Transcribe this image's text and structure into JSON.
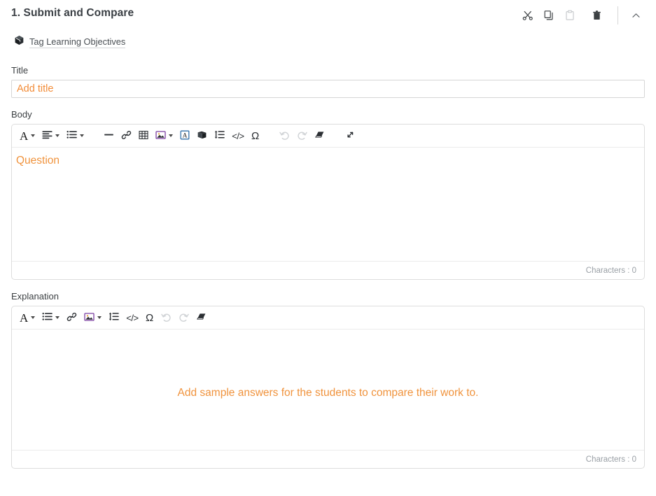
{
  "header": {
    "title": "1. Submit and Compare",
    "actions": [
      {
        "name": "cut-button",
        "icon": "scissors-icon",
        "label": "Cut",
        "disabled": false
      },
      {
        "name": "copy-button",
        "icon": "copy-icon",
        "label": "Copy",
        "disabled": false
      },
      {
        "name": "paste-button",
        "icon": "paste-icon",
        "label": "Paste",
        "disabled": true
      },
      {
        "name": "delete-button",
        "icon": "trash-icon",
        "label": "Delete",
        "disabled": false
      },
      {
        "name": "collapse-button",
        "icon": "chevron-up-icon",
        "label": "Collapse",
        "disabled": false
      }
    ]
  },
  "tag": {
    "icon": "cube-icon",
    "label": "Tag Learning Objectives"
  },
  "title_field": {
    "label": "Title",
    "value": "",
    "placeholder": "Add title"
  },
  "body_field": {
    "label": "Body",
    "placeholder": "Question",
    "character_count": "Characters : 0",
    "toolbar": [
      {
        "name": "font-button",
        "icon": "font-A-icon",
        "glyph": "A",
        "caret": true,
        "disabled": false
      },
      {
        "name": "align-button",
        "icon": "align-left-icon",
        "caret": true,
        "disabled": false
      },
      {
        "name": "list-button",
        "icon": "bullet-list-icon",
        "caret": true,
        "disabled": false
      },
      {
        "name": "horizontal-rule-button",
        "icon": "horizontal-rule-icon",
        "caret": false,
        "disabled": false
      },
      {
        "name": "link-button",
        "icon": "link-icon",
        "caret": false,
        "disabled": false
      },
      {
        "name": "table-button",
        "icon": "table-icon",
        "caret": false,
        "disabled": false
      },
      {
        "name": "image-button",
        "icon": "image-icon",
        "caret": true,
        "disabled": false
      },
      {
        "name": "text-box-button",
        "icon": "text-box-icon",
        "caret": false,
        "disabled": false
      },
      {
        "name": "flashcard-button",
        "icon": "book-icon",
        "caret": false,
        "disabled": false
      },
      {
        "name": "line-height-button",
        "icon": "line-height-icon",
        "caret": false,
        "disabled": false
      },
      {
        "name": "code-button",
        "icon": "code-icon",
        "glyph": "</>",
        "caret": false,
        "disabled": false
      },
      {
        "name": "special-character-button",
        "icon": "omega-icon",
        "glyph": "Ω",
        "caret": false,
        "disabled": false
      },
      {
        "name": "undo-button",
        "icon": "undo-icon",
        "caret": false,
        "disabled": true
      },
      {
        "name": "redo-button",
        "icon": "redo-icon",
        "caret": false,
        "disabled": true
      },
      {
        "name": "clear-format-button",
        "icon": "eraser-icon",
        "caret": false,
        "disabled": false
      },
      {
        "name": "fullscreen-button",
        "icon": "expand-icon",
        "caret": false,
        "disabled": false
      }
    ]
  },
  "explanation_field": {
    "label": "Explanation",
    "placeholder": "Add sample answers for the students to compare their work to.",
    "character_count": "Characters : 0",
    "toolbar": [
      {
        "name": "font-button",
        "icon": "font-A-icon",
        "glyph": "A",
        "caret": true,
        "disabled": false
      },
      {
        "name": "list-button",
        "icon": "bullet-list-icon",
        "caret": true,
        "disabled": false
      },
      {
        "name": "link-button",
        "icon": "link-icon",
        "caret": false,
        "disabled": false
      },
      {
        "name": "image-button",
        "icon": "image-icon",
        "caret": true,
        "disabled": false
      },
      {
        "name": "line-height-button",
        "icon": "line-height-icon",
        "caret": false,
        "disabled": false
      },
      {
        "name": "code-button",
        "icon": "code-icon",
        "glyph": "</>",
        "caret": false,
        "disabled": false
      },
      {
        "name": "special-character-button",
        "icon": "omega-icon",
        "glyph": "Ω",
        "caret": false,
        "disabled": false
      },
      {
        "name": "undo-button",
        "icon": "undo-icon",
        "caret": false,
        "disabled": true
      },
      {
        "name": "redo-button",
        "icon": "redo-icon",
        "caret": false,
        "disabled": true
      },
      {
        "name": "clear-format-button",
        "icon": "eraser-icon",
        "caret": false,
        "disabled": false
      }
    ]
  },
  "colors": {
    "accent_orange": "#f0933d",
    "text_dark": "#3c4043",
    "muted_gray": "#9aa0a6",
    "border_gray": "#dddddd"
  }
}
